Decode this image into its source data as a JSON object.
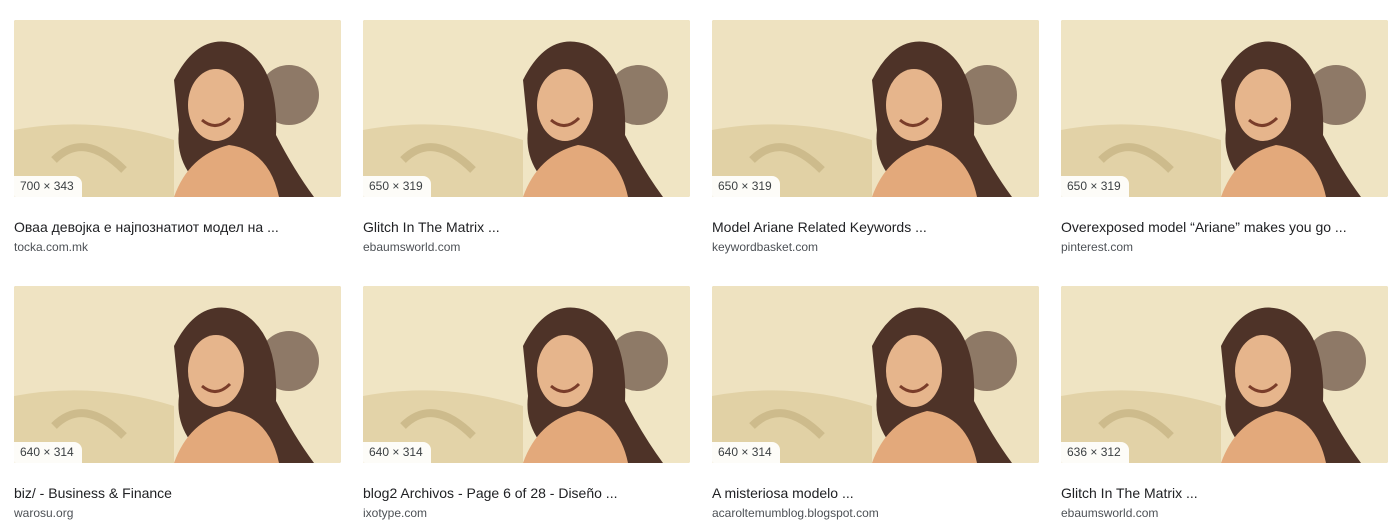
{
  "results": [
    {
      "dimensions": "700 × 343",
      "title": "Оваа девојка е најпознатиот модел на ...",
      "source": "tocka.com.mk"
    },
    {
      "dimensions": "650 × 319",
      "title": "Glitch In The Matrix ...",
      "source": "ebaumsworld.com"
    },
    {
      "dimensions": "650 × 319",
      "title": "Model Ariane Related Keywords ...",
      "source": "keywordbasket.com"
    },
    {
      "dimensions": "650 × 319",
      "title": "Overexposed model “Ariane” makes you go ...",
      "source": "pinterest.com"
    },
    {
      "dimensions": "640 × 314",
      "title": "biz/ - Business & Finance",
      "source": "warosu.org"
    },
    {
      "dimensions": "640 × 314",
      "title": "blog2 Archivos - Page 6 of 28 - Diseño ...",
      "source": "ixotype.com"
    },
    {
      "dimensions": "640 × 314",
      "title": "A misteriosa modelo ...",
      "source": "acaroltemumblog.blogspot.com"
    },
    {
      "dimensions": "636 × 312",
      "title": "Glitch In The Matrix ...",
      "source": "ebaumsworld.com"
    }
  ]
}
